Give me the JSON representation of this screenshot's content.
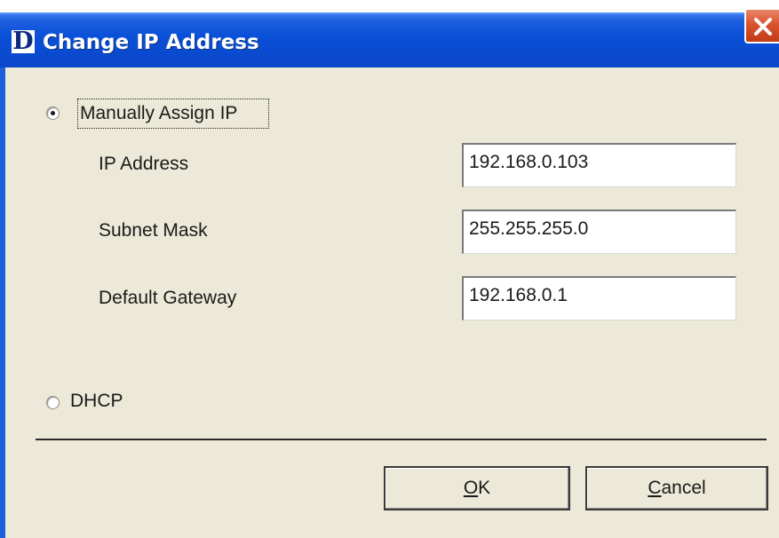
{
  "window": {
    "title": "Change IP Address",
    "logo_letter": "D",
    "close_icon": "close-icon"
  },
  "mode": {
    "manual_label": "Manually Assign IP",
    "manual_selected": true,
    "dhcp_label": "DHCP",
    "dhcp_selected": false
  },
  "fields": {
    "ip_address": {
      "label": "IP Address",
      "value": "192.168.0.103"
    },
    "subnet_mask": {
      "label": "Subnet Mask",
      "value": "255.255.255.0"
    },
    "default_gateway": {
      "label": "Default Gateway",
      "value": "192.168.0.1"
    }
  },
  "buttons": {
    "ok_mnemonic": "O",
    "ok_rest": "K",
    "cancel_mnemonic": "C",
    "cancel_rest": "ancel"
  },
  "colors": {
    "titlebar": "#0a50d8",
    "dialog_bg": "#ece9d8",
    "close_red": "#d9532f"
  }
}
